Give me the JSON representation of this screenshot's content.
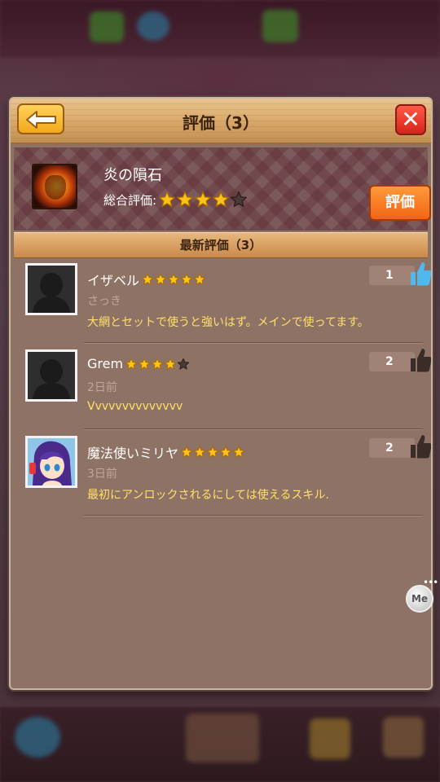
{
  "dialog": {
    "title": "評価（3）",
    "back_icon": "back-arrow-icon",
    "close_icon": "close-icon"
  },
  "skill": {
    "name": "炎の隕石",
    "overall_label": "総合評価:",
    "overall_rating": 4,
    "max_rating": 5,
    "rate_button": "評価"
  },
  "section": {
    "title": "最新評価（3）"
  },
  "reviews": [
    {
      "name": "イザベル",
      "rating": 5,
      "time": "さっき",
      "comment": "大網とセットで使うと強いはず。メインで使ってます。",
      "likes": "1",
      "liked": true
    },
    {
      "name": "Grem",
      "rating": 4,
      "time": "2日前",
      "comment": "Vvvvvvvvvvvvvv",
      "likes": "2",
      "liked": false
    },
    {
      "name": "魔法使いミリヤ",
      "rating": 5,
      "time": "3日前",
      "comment": "最初にアンロックされるにしては使えるスキル.",
      "likes": "2",
      "liked": false
    }
  ],
  "overlay": {
    "me_label": "Me",
    "me_dots": "•••"
  },
  "colors": {
    "star_on": "#ffc21a",
    "star_off": "#4a3a36",
    "thumb_liked": "#4fb8ec",
    "thumb_default": "#3b2c28"
  }
}
